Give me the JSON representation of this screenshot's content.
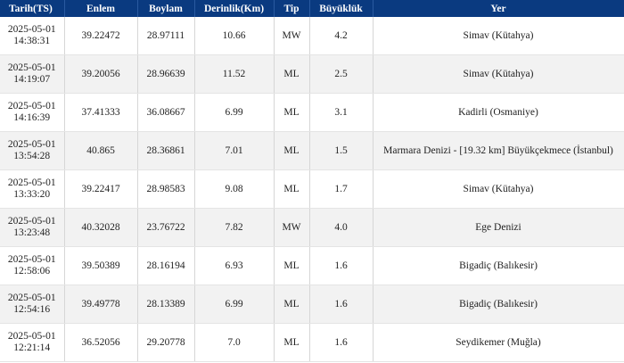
{
  "table": {
    "headers": [
      "Tarih(TS)",
      "Enlem",
      "Boylam",
      "Derinlik(Km)",
      "Tip",
      "Büyüklük",
      "Yer"
    ],
    "rows": [
      {
        "date": "2025-05-01",
        "time": "14:38:31",
        "enlem": "39.22472",
        "boylam": "28.97111",
        "derinlik": "10.66",
        "tip": "MW",
        "buyukluk": "4.2",
        "yer": "Simav (Kütahya)"
      },
      {
        "date": "2025-05-01",
        "time": "14:19:07",
        "enlem": "39.20056",
        "boylam": "28.96639",
        "derinlik": "11.52",
        "tip": "ML",
        "buyukluk": "2.5",
        "yer": "Simav (Kütahya)"
      },
      {
        "date": "2025-05-01",
        "time": "14:16:39",
        "enlem": "37.41333",
        "boylam": "36.08667",
        "derinlik": "6.99",
        "tip": "ML",
        "buyukluk": "3.1",
        "yer": "Kadirli (Osmaniye)"
      },
      {
        "date": "2025-05-01",
        "time": "13:54:28",
        "enlem": "40.865",
        "boylam": "28.36861",
        "derinlik": "7.01",
        "tip": "ML",
        "buyukluk": "1.5",
        "yer": "Marmara Denizi - [19.32 km] Büyükçekmece (İstanbul)"
      },
      {
        "date": "2025-05-01",
        "time": "13:33:20",
        "enlem": "39.22417",
        "boylam": "28.98583",
        "derinlik": "9.08",
        "tip": "ML",
        "buyukluk": "1.7",
        "yer": "Simav (Kütahya)"
      },
      {
        "date": "2025-05-01",
        "time": "13:23:48",
        "enlem": "40.32028",
        "boylam": "23.76722",
        "derinlik": "7.82",
        "tip": "MW",
        "buyukluk": "4.0",
        "yer": "Ege Denizi"
      },
      {
        "date": "2025-05-01",
        "time": "12:58:06",
        "enlem": "39.50389",
        "boylam": "28.16194",
        "derinlik": "6.93",
        "tip": "ML",
        "buyukluk": "1.6",
        "yer": "Bigadiç (Balıkesir)"
      },
      {
        "date": "2025-05-01",
        "time": "12:54:16",
        "enlem": "39.49778",
        "boylam": "28.13389",
        "derinlik": "6.99",
        "tip": "ML",
        "buyukluk": "1.6",
        "yer": "Bigadiç (Balıkesir)"
      },
      {
        "date": "2025-05-01",
        "time": "12:21:14",
        "enlem": "36.52056",
        "boylam": "29.20778",
        "derinlik": "7.0",
        "tip": "ML",
        "buyukluk": "1.6",
        "yer": "Seydikemer (Muğla)"
      }
    ]
  },
  "colors": {
    "header_bg": "#0a3a80",
    "header_text": "#ffffff",
    "row_alt": "#f2f2f2"
  }
}
